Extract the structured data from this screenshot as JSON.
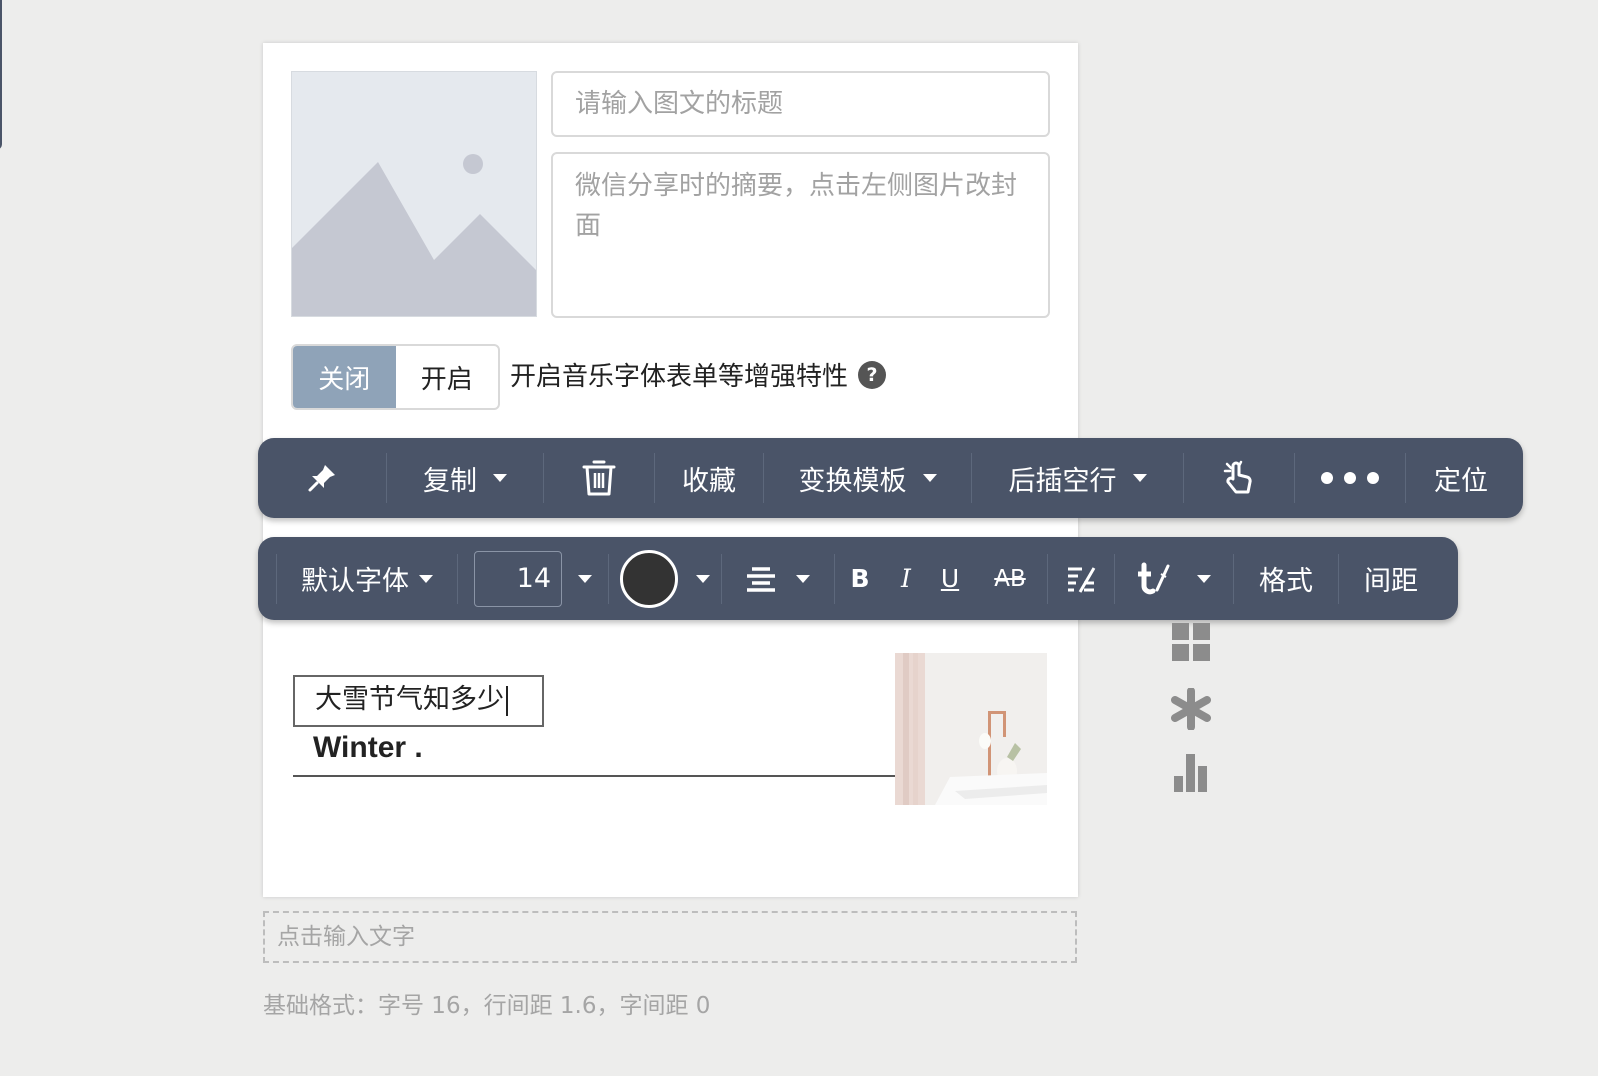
{
  "editor": {
    "title_placeholder": "请输入图文的标题",
    "summary_placeholder": "微信分享时的摘要，点击左侧图片改封面",
    "toggle": {
      "off_label": "关闭",
      "on_label": "开启",
      "selected": "关闭"
    },
    "enhance_label": "开启音乐字体表单等增强特性",
    "help_icon_text": "?",
    "cover_icon": "image-placeholder-icon"
  },
  "block_toolbar": {
    "pin_icon": "pin-icon",
    "copy_label": "复制",
    "delete_icon": "trash-icon",
    "favorite_label": "收藏",
    "change_template_label": "变换模板",
    "insert_blank_label": "后插空行",
    "select_icon": "hand-pointer-icon",
    "more_icon": "more-icon",
    "locate_label": "定位"
  },
  "format_toolbar": {
    "font_label": "默认字体",
    "font_size": "14",
    "text_color": "#333333",
    "align_icon": "align-center-icon",
    "bold_label": "B",
    "italic_label": "I",
    "underline_label": "U",
    "strike_label": "AB",
    "clear_format_icon": "clear-format-icon",
    "text_style_icon": "text-style-icon",
    "format_label": "格式",
    "spacing_label": "间距"
  },
  "content": {
    "heading": "大雪节气知多少",
    "subtitle": "Winter ."
  },
  "side_icons": [
    "grid-icon",
    "asterisk-icon",
    "bar-chart-icon"
  ],
  "text_entry_placeholder": "点击输入文字",
  "format_info": "基础格式：字号 16，行间距 1.6，字间距 0"
}
